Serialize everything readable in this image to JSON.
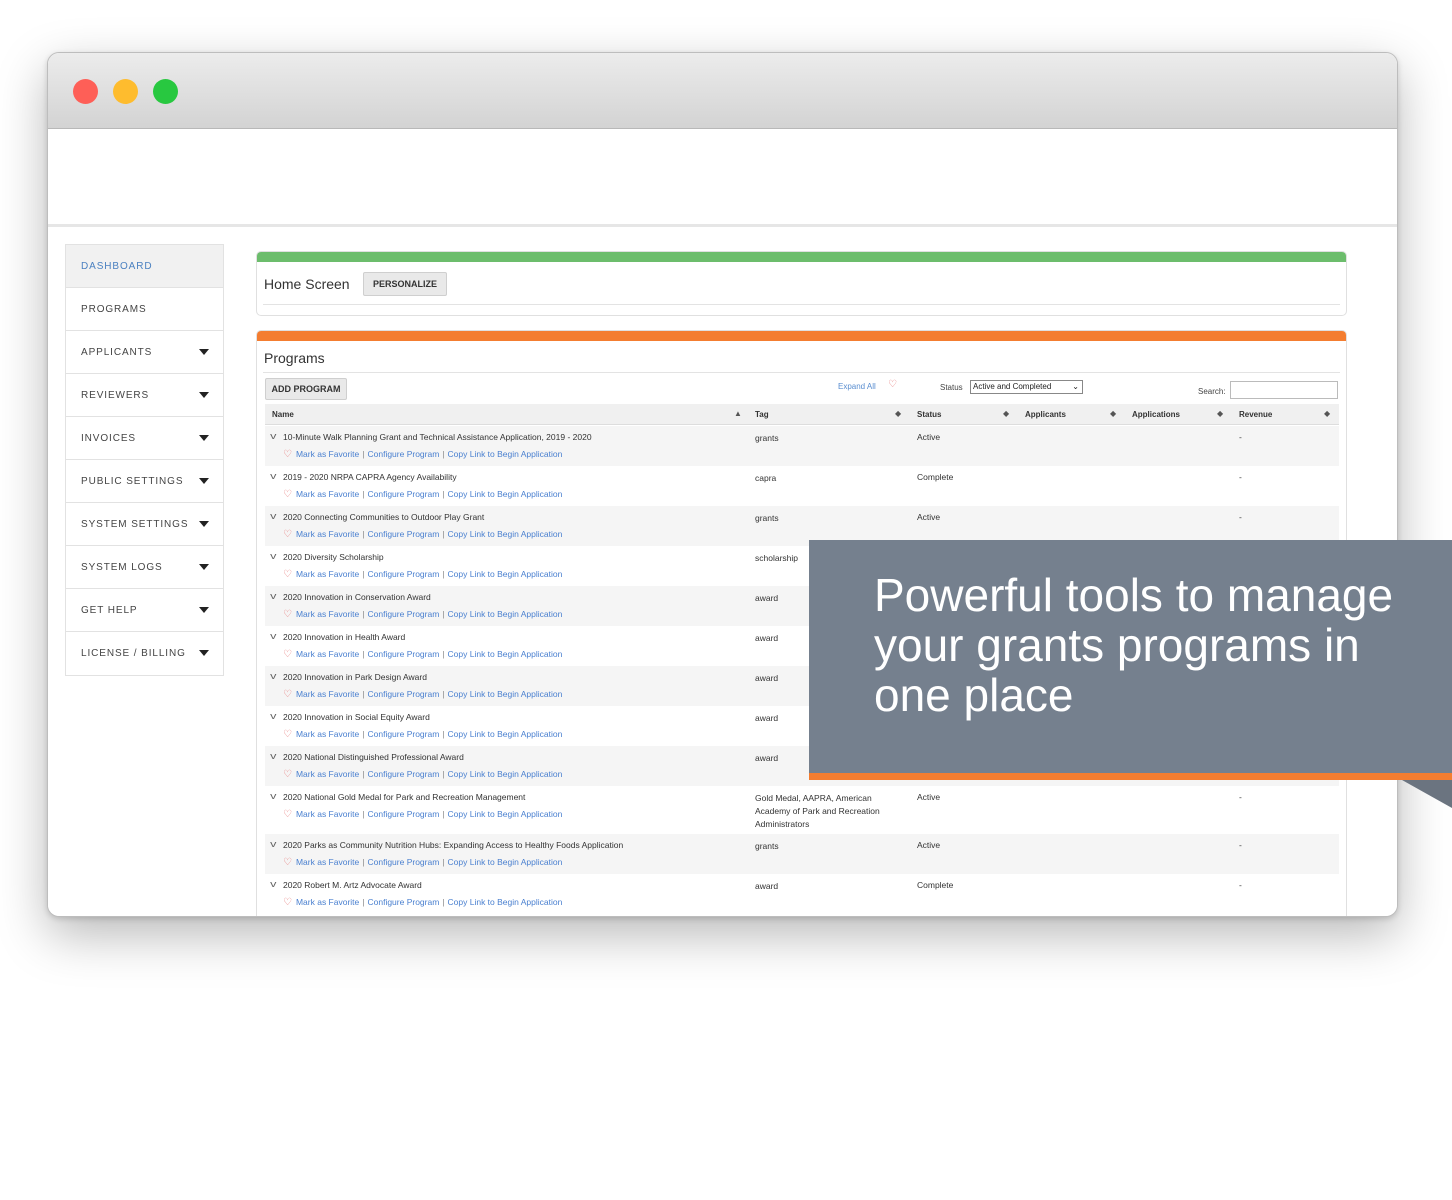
{
  "sidebar": {
    "items": [
      {
        "label": "DASHBOARD",
        "active": true,
        "dropdown": false
      },
      {
        "label": "PROGRAMS",
        "active": false,
        "dropdown": false
      },
      {
        "label": "APPLICANTS",
        "active": false,
        "dropdown": true
      },
      {
        "label": "REVIEWERS",
        "active": false,
        "dropdown": true
      },
      {
        "label": "INVOICES",
        "active": false,
        "dropdown": true
      },
      {
        "label": "PUBLIC SETTINGS",
        "active": false,
        "dropdown": true
      },
      {
        "label": "SYSTEM SETTINGS",
        "active": false,
        "dropdown": true
      },
      {
        "label": "SYSTEM LOGS",
        "active": false,
        "dropdown": true
      },
      {
        "label": "GET HELP",
        "active": false,
        "dropdown": true
      },
      {
        "label": "LICENSE / BILLING",
        "active": false,
        "dropdown": true
      }
    ]
  },
  "home": {
    "title": "Home Screen",
    "personalize_label": "PERSONALIZE",
    "accent": "#6cbd6c"
  },
  "programs": {
    "title": "Programs",
    "accent": "#f47d30",
    "add_label": "ADD PROGRAM",
    "expand_all_label": "Expand All",
    "status_label": "Status",
    "status_value": "Active and Completed",
    "search_label": "Search:",
    "search_value": "",
    "columns": {
      "name": "Name",
      "tag": "Tag",
      "status": "Status",
      "applicants": "Applicants",
      "applications": "Applications",
      "revenue": "Revenue"
    },
    "link_labels": {
      "favorite": "Mark as Favorite",
      "configure": "Configure Program",
      "copy": "Copy Link to Begin Application",
      "separator": "|"
    },
    "rows": [
      {
        "name": "10-Minute Walk Planning Grant and Technical Assistance Application, 2019 - 2020",
        "tag": "grants",
        "status": "Active",
        "revenue": "-"
      },
      {
        "name": "2019 - 2020 NRPA CAPRA Agency Availability",
        "tag": "capra",
        "status": "Complete",
        "revenue": "-"
      },
      {
        "name": "2020 Connecting Communities to Outdoor Play Grant",
        "tag": "grants",
        "status": "Active",
        "revenue": "-"
      },
      {
        "name": "2020 Diversity Scholarship",
        "tag": "scholarship",
        "status": "",
        "revenue": ""
      },
      {
        "name": "2020 Innovation in Conservation Award",
        "tag": "award",
        "status": "",
        "revenue": ""
      },
      {
        "name": "2020 Innovation in Health Award",
        "tag": "award",
        "status": "",
        "revenue": ""
      },
      {
        "name": "2020 Innovation in Park Design Award",
        "tag": "award",
        "status": "",
        "revenue": ""
      },
      {
        "name": "2020 Innovation in Social Equity Award",
        "tag": "award",
        "status": "",
        "revenue": ""
      },
      {
        "name": "2020 National Distinguished Professional Award",
        "tag": "award",
        "status": "",
        "revenue": ""
      },
      {
        "name": "2020 National Gold Medal for Park and Recreation Management",
        "tag": "Gold Medal, AAPRA, American Academy of Park and Recreation Administrators",
        "status": "Active",
        "revenue": "-"
      },
      {
        "name": "2020 Parks as Community Nutrition Hubs: Expanding Access to Healthy Foods Application",
        "tag": "grants",
        "status": "Active",
        "revenue": "-"
      },
      {
        "name": "2020 Robert M. Artz Advocate Award",
        "tag": "award",
        "status": "Complete",
        "revenue": "-"
      }
    ]
  },
  "callout": {
    "text": "Powerful tools to manage your grants programs in one place",
    "background": "#75808e",
    "accent": "#f47d30"
  }
}
